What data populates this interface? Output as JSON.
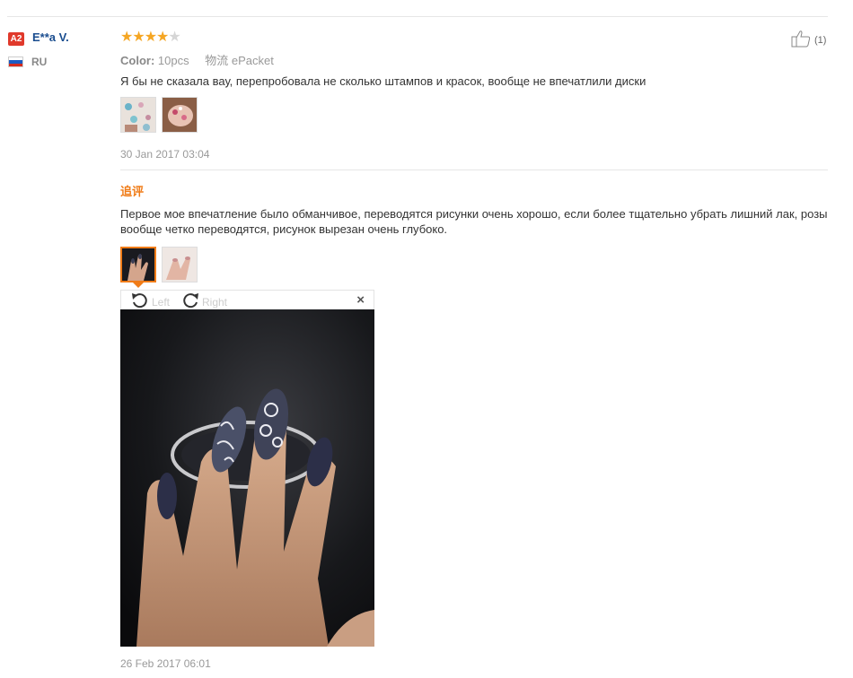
{
  "reviewer": {
    "level_badge": "A2",
    "name": "E**a V.",
    "country": "RU"
  },
  "rating": {
    "value": 4,
    "max": 5
  },
  "product_meta": {
    "color_label": "Color:",
    "color_value": "10pcs",
    "shipping": "物流 ePacket"
  },
  "helpful": {
    "count": "(1)"
  },
  "review": {
    "text": "Я бы не сказала вау, перепробовала не сколько штампов и красок, вообще не впечатлили диски",
    "photos": [
      "thumb-stamps",
      "thumb-nails-pink"
    ],
    "date": "30 Jan 2017 03:04"
  },
  "followup": {
    "label": "追评",
    "text": "Первое мое впечатление было обманчивое, переводятся рисунки очень хорошо, если более тщательно убрать лишний лак, розы вообще четко переводятся, рисунок вырезан очень глубоко.",
    "photos": [
      "thumb-hand-dark",
      "thumb-hand-light"
    ],
    "date": "26 Feb 2017 06:01"
  },
  "viewer": {
    "rotate_left_label": "Left",
    "rotate_right_label": "Right",
    "close_label": "×"
  },
  "colors": {
    "accent_orange": "#f07c18",
    "star": "#f5a623",
    "username_blue": "#1a4d8f",
    "badge_red": "#e0392b"
  }
}
